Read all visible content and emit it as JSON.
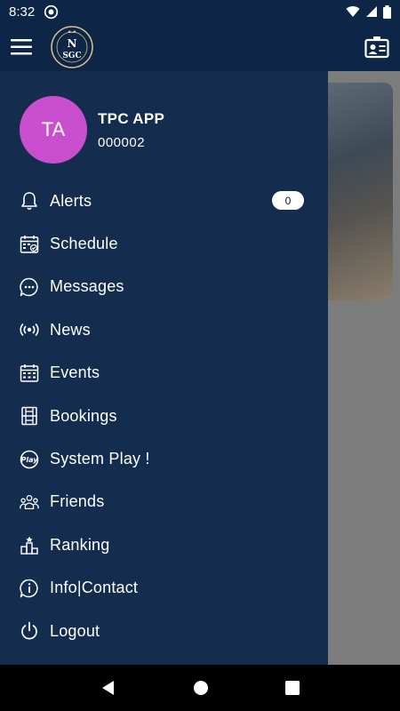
{
  "status_bar": {
    "time": "8:32"
  },
  "app_bar": {
    "logo_text": "NSGC",
    "icons": [
      "hamburger-menu-icon",
      "club-logo",
      "member-card-icon"
    ]
  },
  "drawer": {
    "profile": {
      "initials": "TA",
      "name": "TPC APP",
      "member_id": "000002",
      "avatar_color": "#c94fcf"
    },
    "items": [
      {
        "label": "Alerts",
        "icon": "bell-icon",
        "badge": "0"
      },
      {
        "label": "Schedule",
        "icon": "calendar-check-icon"
      },
      {
        "label": "Messages",
        "icon": "chat-bubble-icon"
      },
      {
        "label": "News",
        "icon": "broadcast-icon"
      },
      {
        "label": "Events",
        "icon": "calendar-grid-icon"
      },
      {
        "label": "Bookings",
        "icon": "court-icon"
      },
      {
        "label": "System Play !",
        "icon": "play-badge-icon"
      },
      {
        "label": "Friends",
        "icon": "people-icon"
      },
      {
        "label": "Ranking",
        "icon": "podium-icon"
      },
      {
        "label": "Info|Contact",
        "icon": "info-icon"
      },
      {
        "label": "Logout",
        "icon": "power-icon"
      }
    ]
  },
  "colors": {
    "primary": "#0d2547",
    "drawer": "#142d4f",
    "accent": "#c94fcf"
  }
}
